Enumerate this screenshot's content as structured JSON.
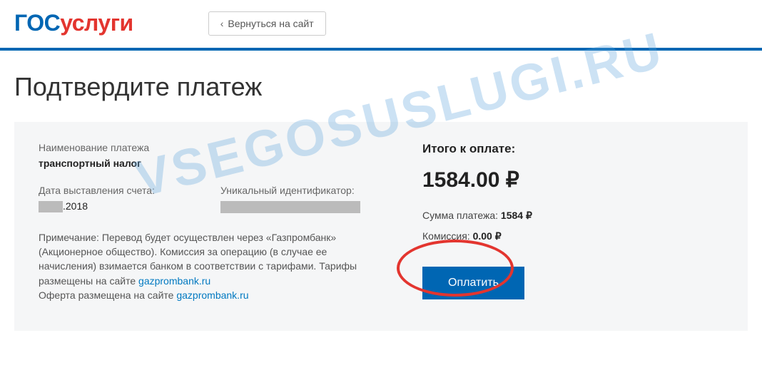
{
  "header": {
    "logo_part1": "гос",
    "logo_part2": "услуги",
    "back_label": "Вернуться на сайт"
  },
  "page": {
    "title": "Подтвердите платеж"
  },
  "left": {
    "name_label": "Наименование платежа",
    "name_value": "транспортный налог",
    "date_label": "Дата выставления счета:",
    "date_value_suffix": ".2018",
    "uid_label": "Уникальный идентификатор:",
    "note_prefix": "Примечание: Перевод будет осуществлен через «Газпромбанк» (Акционерное общество). Комиссия за операцию (в случае ее начисления) взимается банком в соответствии с тарифами. Тарифы размещены на сайте ",
    "note_link1": "gazprombank.ru",
    "note_mid": "Оферта размещена на сайте ",
    "note_link2": "gazprombank.ru"
  },
  "right": {
    "total_label": "Итого к оплате:",
    "total_amount": "1584.00 ₽",
    "sum_label": "Сумма платежа: ",
    "sum_value": "1584 ₽",
    "fee_label": "Комиссия: ",
    "fee_value": "0.00 ₽",
    "pay_label": "Оплатить"
  },
  "watermark": "VSEGOSUSLUGI.RU"
}
